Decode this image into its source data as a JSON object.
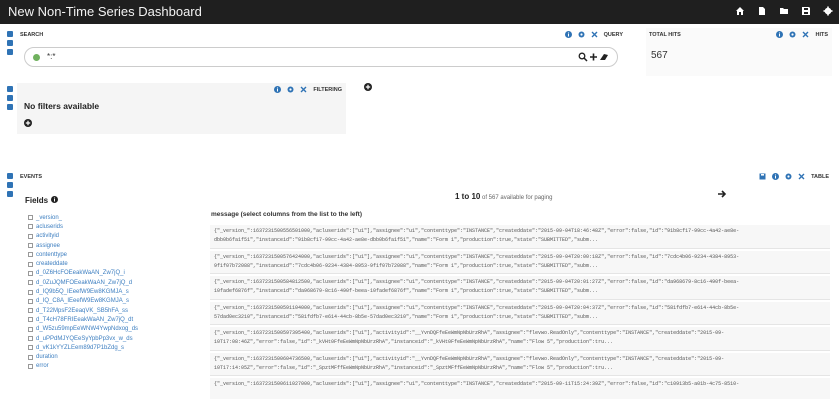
{
  "app": {
    "title": "New Non-Time Series Dashboard"
  },
  "topbar_icons": [
    "home-icon",
    "new-document-icon",
    "open-folder-icon",
    "save-icon",
    "settings-icon"
  ],
  "search": {
    "title": "SEARCH",
    "label": "QUERY",
    "query": "*:*",
    "buttons": [
      "search-icon",
      "add-query-icon",
      "clear-query-icon"
    ]
  },
  "filtering": {
    "label": "FILTERING",
    "empty_text": "No filters available"
  },
  "total_hits": {
    "title": "TOTAL HITS",
    "label": "HITS",
    "value": "567"
  },
  "events": {
    "title": "EVENTS",
    "label": "TABLE",
    "fields_title": "Fields",
    "paging": {
      "range": "1 to 10",
      "suffix": "of 567 available for paging"
    },
    "column_header": "message (select columns from the list to the left)",
    "fields": [
      "_version_",
      "acluserids",
      "activityid",
      "assignee",
      "contenttype",
      "createddate",
      "d_0Z6HcFOEeakWaAN_Zw7jQ_i",
      "d_0ZuJQMFOEeakWaAN_Zw7jQ_d",
      "d_IQ9b5Q_IEeefW9Ew8KGMJA_s",
      "d_IQ_C8A_IEeefW9Ew8KGMJA_s",
      "d_T22MpsF2EeaqVK_SB5hFA_ss",
      "d_T4cH78FRIEeakWaAN_Zw7jQ_dt",
      "d_W5zu59mpEeWNW4YwpNdxog_ds",
      "d_uPPdMJYQEeSyYpbPp3vx_w_ds",
      "d_vK1kYYZLEem89d7P1bZdg_s",
      "duration",
      "error"
    ],
    "rows": [
      {
        "line1": "{\"_version_\":1637231500556501000,\"acluserids\":[\"u1\"],\"assignee\":\"u1\",\"contenttype\":\"INSTANCE\",\"createddate\":\"2015-09-04T18:46:48Z\",\"error\":false,\"id\":\"91b8cf17-99cc-4a42-ae8e-",
        "line2": "dbb0b6fa1f51\",\"instanceid\":\"91b8cf17-99cc-4a42-ae8e-dbb0b6fa1f51\",\"name\":\"Form 1\",\"production\":true,\"state\":\"SUBMITTED\",\"subm..."
      },
      {
        "line1": "{\"_version_\":1637231500576424000,\"acluserids\":[\"u1\"],\"assignee\":\"u1\",\"contenttype\":\"INSTANCE\",\"createddate\":\"2015-09-04T20:00:18Z\",\"error\":false,\"id\":\"7cdc4b06-9234-4384-8953-",
        "line2": "9f1f07b72088\",\"instanceid\":\"7cdc4b06-9234-4384-8953-9f1f07b72088\",\"name\":\"Form 1\",\"production\":true,\"state\":\"SUBMITTED\",\"subm..."
      },
      {
        "line1": "{\"_version_\":1637231500584812500,\"acluserids\":[\"u1\"],\"assignee\":\"u1\",\"contenttype\":\"INSTANCE\",\"createddate\":\"2015-09-04T20:01:27Z\",\"error\":false,\"id\":\"da968679-8c16-490f-beea-",
        "line2": "10fadef6876f\",\"instanceid\":\"da968679-8c16-490f-beea-10fadef6876f\",\"name\":\"Form 1\",\"production\":true,\"state\":\"SUBMITTED\",\"subm..."
      },
      {
        "line1": "{\"_version_\":1637231500591104000,\"acluserids\":[\"u1\"],\"assignee\":\"u1\",\"contenttype\":\"INSTANCE\",\"createddate\":\"2015-09-04T20:04:37Z\",\"error\":false,\"id\":\"581fdfb7-e614-44cb-8b5e-",
        "line2": "57dad0ec3210\",\"instanceid\":\"581fdfb7-e614-44cb-8b5e-57dad0ec3210\",\"name\":\"Form 1\",\"production\":true,\"state\":\"SUBMITTED\",\"subm..."
      },
      {
        "line1": "{\"_version_\":1637231500597395400,\"acluserids\":[\"u1\"],\"activityid\":\"__YvnDQFfeEeWmNpNbUrzRhA\",\"assignee\":\"flevwo.ReadOnly\",\"contenttype\":\"INSTANCE\",\"createddate\":\"2015-09-",
        "line2": "10T17:08:46Z\",\"error\":false,\"id\":\"_kVHt0FfeEeWmNpNbUrzRhA\",\"instanceid\":\"_kVHt0FfeEeWmNpNbUrzRhA\",\"name\":\"Flow 5\",\"production\":tru..."
      },
      {
        "line1": "{\"_version_\":1637231500604736500,\"acluserids\":[\"u1\"],\"activityid\":\"__YvnDQFfeEeWmNpNbUrzRhA\",\"assignee\":\"flevwo.ReadOnly\",\"contenttype\":\"INSTANCE\",\"createddate\":\"2015-09-",
        "line2": "10T17:14:05Z\",\"error\":false,\"id\":\"_SpztMFffEeWmNpNbUrzRhA\",\"instanceid\":\"_SpztMFffEeWmNpNbUrzRhA\",\"name\":\"Flow 5\",\"production\":tru..."
      },
      {
        "line1": "{\"_version_\":1637231500611027000,\"acluserids\":[\"u1\"],\"assignee\":\"u1\",\"contenttype\":\"INSTANCE\",\"createddate\":\"2015-09-11T15:24:39Z\",\"error\":false,\"id\":\"c10913b5-a01b-4c75-8510-",
        "line2": ""
      }
    ]
  },
  "colors": {
    "accent": "#2f73b5",
    "topbar": "#1f1f1f",
    "link": "#3c7ec0",
    "status_dot": "#70b15e"
  }
}
